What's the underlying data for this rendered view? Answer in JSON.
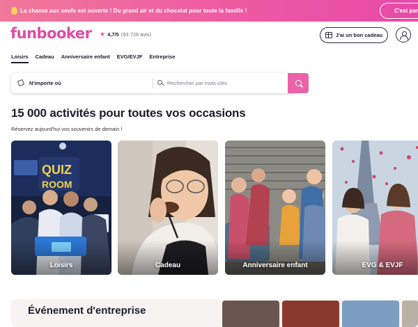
{
  "promo": {
    "text": "La chasse aux oeufs est ouverte ! Du grand air et du chocolat pour toute la famille !",
    "button": "C'est parti",
    "icon": "egg-icon"
  },
  "header": {
    "logo": "funbooker",
    "rating_value": "4,7/5",
    "rating_count": "(93 726 avis)",
    "gift_button": "J'ai un bon cadeau",
    "account_icon": "user-icon"
  },
  "nav": {
    "items": [
      "Loisirs",
      "Cadeau",
      "Anniversaire enfant",
      "EVG/EVJF",
      "Entreprise"
    ],
    "active": "Loisirs"
  },
  "search": {
    "location": "N'importe où",
    "placeholder": "Rechercher par mots-clés"
  },
  "main": {
    "title": "15 000 activités pour toutes vos occasions",
    "subtitle": "Réservez aujourd'hui vos souvenirs de demain !"
  },
  "categories": [
    {
      "label": "Loisirs"
    },
    {
      "label": "Cadeau"
    },
    {
      "label": "Anniversaire enfant"
    },
    {
      "label": "EVG & EVJF"
    }
  ],
  "bottom": {
    "title": "Événement d'entreprise"
  },
  "colors": {
    "brand": "#e04aa6",
    "promo_start": "#f0789a",
    "search_button": "#ec62a9"
  }
}
